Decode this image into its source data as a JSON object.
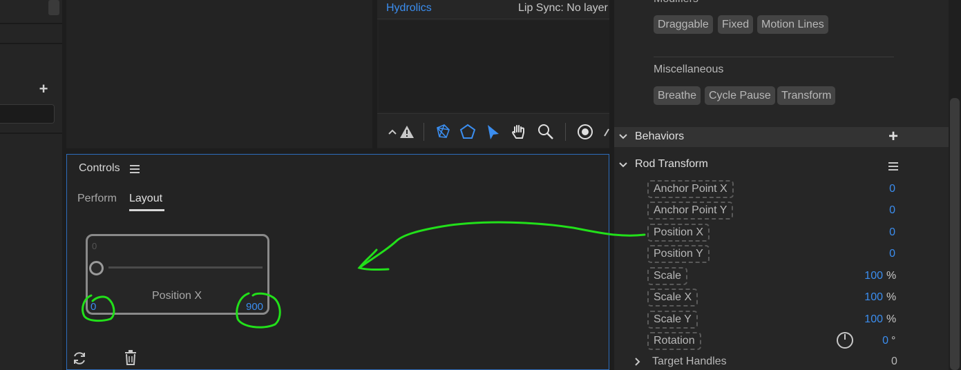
{
  "timeline": {
    "track_label": "Hydrolics",
    "lip_sync": "Lip Sync: No layer"
  },
  "toolbar": {
    "tools": [
      "chevron-up-icon",
      "warning-icon",
      "mesh-icon",
      "polygon-icon",
      "select-arrow-icon",
      "hand-icon",
      "zoom-icon",
      "record-icon",
      "pen-icon"
    ]
  },
  "controls": {
    "title": "Controls",
    "tabs": [
      "Perform",
      "Layout"
    ],
    "active_tab": "Layout",
    "slider": {
      "top_value": "0",
      "label": "Position X",
      "min": "0",
      "max": "900",
      "level": 0
    }
  },
  "properties": {
    "modifiers_label": "Modifiers",
    "modifier_tags": [
      "Draggable",
      "Fixed",
      "Motion Lines"
    ],
    "misc_label": "Miscellaneous",
    "misc_tags": [
      "Breathe",
      "Cycle Pause",
      "Transform"
    ],
    "behaviors_label": "Behaviors",
    "behavior_name": "Rod Transform",
    "params": [
      {
        "name": "Anchor Point X",
        "value": "0",
        "unit": ""
      },
      {
        "name": "Anchor Point Y",
        "value": "0",
        "unit": ""
      },
      {
        "name": "Position X",
        "value": "0",
        "unit": ""
      },
      {
        "name": "Position Y",
        "value": "0",
        "unit": ""
      },
      {
        "name": "Scale",
        "value": "100",
        "unit": "%"
      },
      {
        "name": "Scale X",
        "value": "100",
        "unit": "%"
      },
      {
        "name": "Scale Y",
        "value": "100",
        "unit": "%"
      },
      {
        "name": "Rotation",
        "value": "0",
        "unit": "°"
      }
    ],
    "target_handles_label": "Target Handles",
    "target_handles_value": "0"
  },
  "colors": {
    "accent": "#3b8ef0",
    "annotation": "#22e01a",
    "panel_border": "#2d6dbd"
  }
}
